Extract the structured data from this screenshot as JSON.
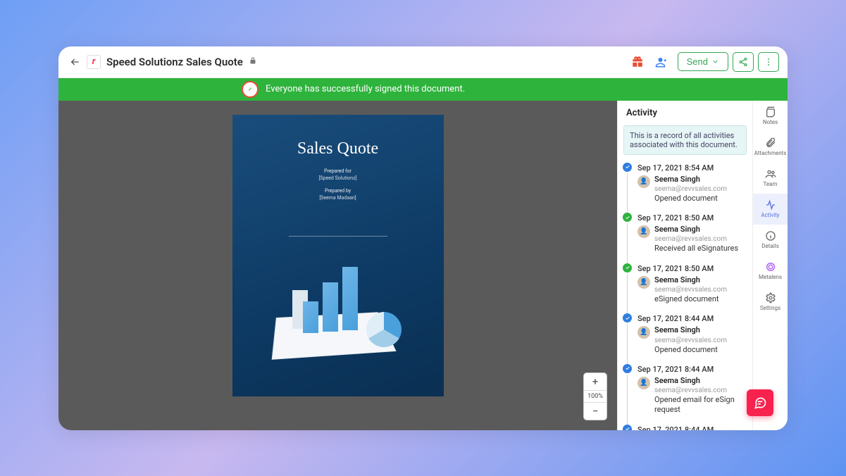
{
  "topbar": {
    "doc_title": "Speed Solutionz Sales Quote",
    "send_label": "Send"
  },
  "banner": {
    "text": "Everyone has successfully signed this document."
  },
  "doc": {
    "title": "Sales Quote",
    "prepared_for_label": "Prepared for",
    "prepared_for_value": "[Speed Solutionz]",
    "prepared_by_label": "Prepared by",
    "prepared_by_value": "[Seema Madaan]"
  },
  "zoom": {
    "level": "100%"
  },
  "activity": {
    "header": "Activity",
    "description": "This is a record of all activities associated with this document.",
    "items": [
      {
        "status": "blue",
        "time": "Sep 17, 2021 8:54 AM",
        "name": "Seema Singh",
        "email": "seema@revvsales.com",
        "action": "Opened document"
      },
      {
        "status": "green",
        "time": "Sep 17, 2021 8:50 AM",
        "name": "Seema Singh",
        "email": "seema@revvsales.com",
        "action": "Received all eSignatures"
      },
      {
        "status": "green",
        "time": "Sep 17, 2021 8:50 AM",
        "name": "Seema Singh",
        "email": "seema@revvsales.com",
        "action": "eSigned document"
      },
      {
        "status": "blue",
        "time": "Sep 17, 2021 8:44 AM",
        "name": "Seema Singh",
        "email": "seema@revvsales.com",
        "action": "Opened document"
      },
      {
        "status": "blue",
        "time": "Sep 17, 2021 8:44 AM",
        "name": "Seema Singh",
        "email": "seema@revvsales.com",
        "action": "Opened email for eSign request"
      },
      {
        "status": "blue",
        "time": "Sep 17, 2021 8:44 AM",
        "name": "",
        "email": "",
        "action": ""
      }
    ]
  },
  "rail": {
    "notes": "Notes",
    "attachments": "Attachments",
    "team": "Team",
    "activity": "Activity",
    "details": "Details",
    "metalens": "Metalens",
    "settings": "Settings"
  }
}
